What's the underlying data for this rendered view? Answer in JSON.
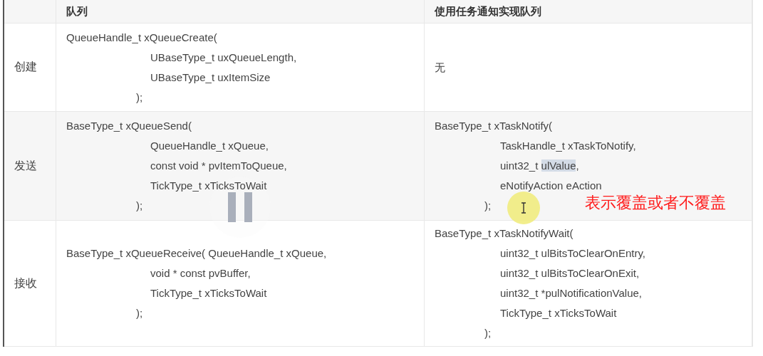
{
  "table": {
    "columns": [
      "队列",
      "使用任务通知实现队列"
    ],
    "rows": [
      {
        "label": "创建",
        "cells": [
          {
            "kind": "code",
            "signature": "QueueHandle_t xQueueCreate(",
            "params": [
              "UBaseType_t uxQueueLength,",
              "UBaseType_t uxItemSize"
            ],
            "close": ");"
          },
          {
            "kind": "text",
            "text": "无"
          }
        ]
      },
      {
        "label": "发送",
        "cells": [
          {
            "kind": "code",
            "signature": "BaseType_t xQueueSend(",
            "params": [
              "QueueHandle_t xQueue,",
              "const void * pvItemToQueue,",
              "TickType_t xTicksToWait"
            ],
            "close": ");"
          },
          {
            "kind": "code",
            "signature": "BaseType_t xTaskNotify(",
            "params": [
              "TaskHandle_t xTaskToNotify,",
              {
                "parts": [
                  {
                    "text": "uint32_t ",
                    "selected": false
                  },
                  {
                    "text": "ulValue",
                    "selected": true
                  },
                  {
                    "text": ",",
                    "selected": false
                  }
                ]
              },
              "eNotifyAction eAction"
            ],
            "close": ");"
          }
        ]
      },
      {
        "label": "接收",
        "cells": [
          {
            "kind": "code",
            "signature": "BaseType_t xQueueReceive( QueueHandle_t xQueue,",
            "params": [
              "void * const pvBuffer,",
              "TickType_t xTicksToWait"
            ],
            "close": ");"
          },
          {
            "kind": "code",
            "signature": "BaseType_t xTaskNotifyWait(",
            "params": [
              "uint32_t ulBitsToClearOnEntry,",
              "uint32_t ulBitsToClearOnExit,",
              "uint32_t *pulNotificationValue,",
              "TickType_t xTicksToWait"
            ],
            "close": ");"
          }
        ]
      }
    ]
  },
  "player": {
    "paused": true
  },
  "annotation": {
    "text": "表示覆盖或者不覆盖"
  }
}
